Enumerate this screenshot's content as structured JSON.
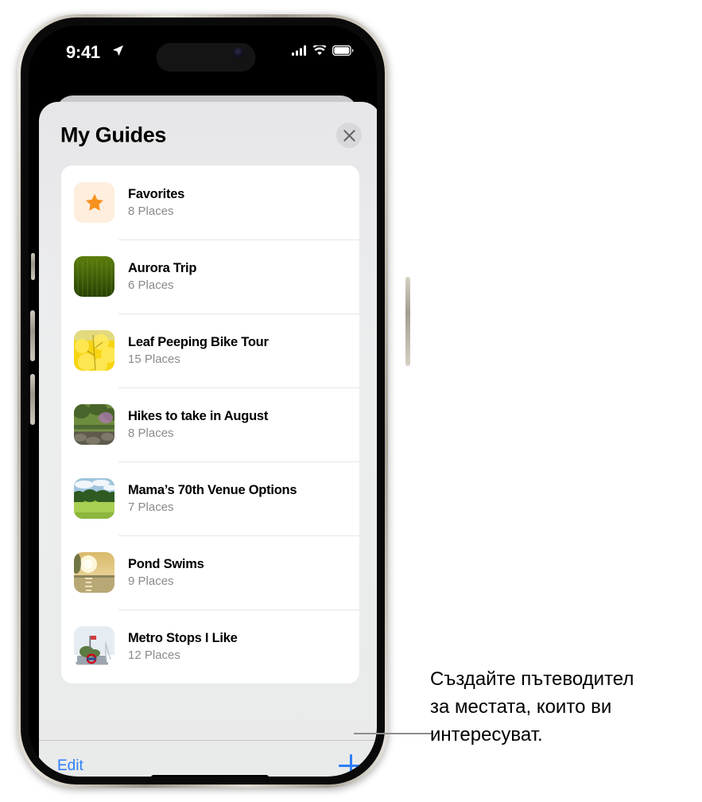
{
  "status_bar": {
    "time": "9:41",
    "location_icon": "location-arrow-icon",
    "cellular_icon": "cellular-bars-icon",
    "wifi_icon": "wifi-icon",
    "battery_icon": "battery-icon"
  },
  "sheet": {
    "title": "My Guides",
    "close_label": "×"
  },
  "guides": [
    {
      "title": "Favorites",
      "places": "8 Places",
      "thumb": "star-icon"
    },
    {
      "title": "Aurora Trip",
      "places": "6 Places",
      "thumb": "green-field-photo"
    },
    {
      "title": "Leaf Peeping Bike Tour",
      "places": "15 Places",
      "thumb": "yellow-foliage-photo"
    },
    {
      "title": "Hikes to take in August",
      "places": "8 Places",
      "thumb": "forest-trail-photo"
    },
    {
      "title": "Mama’s 70th Venue Options",
      "places": "7 Places",
      "thumb": "meadow-photo"
    },
    {
      "title": "Pond Swims",
      "places": "9 Places",
      "thumb": "sunset-lake-photo"
    },
    {
      "title": "Metro Stops I Like",
      "places": "12 Places",
      "thumb": "monument-photo"
    }
  ],
  "toolbar": {
    "edit_label": "Edit",
    "add_label": "add-icon"
  },
  "callout": {
    "line1": "Създайте пътеводител",
    "line2": "за местата, които ви",
    "line3": "интересуват."
  },
  "colors": {
    "accent_blue": "#2d7ff9",
    "star_orange": "#f7911e",
    "star_bg": "#fdeedd",
    "sheet_bg": "#eaeaec",
    "secondary_text": "#8a8a8e"
  }
}
